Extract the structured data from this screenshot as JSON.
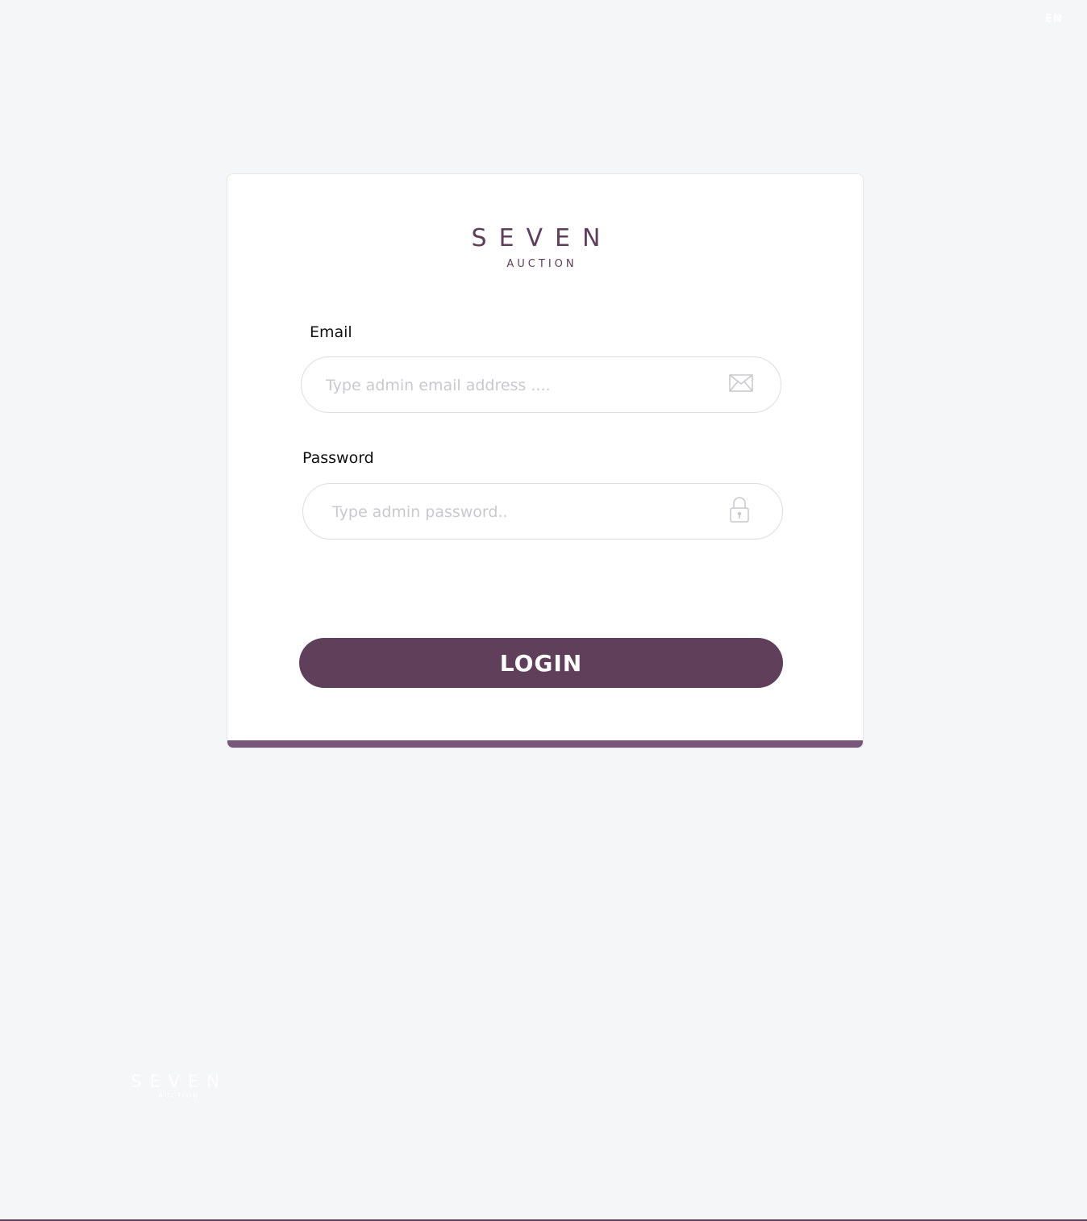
{
  "header": {
    "language": "EN"
  },
  "brand": {
    "name": "SEVEN",
    "subtitle": "AUCTION",
    "color": "#5f3d5b"
  },
  "login_form": {
    "email_label": "Email",
    "email_placeholder": "Type admin email address ....",
    "email_icon": "envelope-icon",
    "password_label": "Password",
    "password_placeholder": "Type admin password..",
    "password_icon": "lock-icon",
    "submit_label": "LOGIN"
  },
  "footer": {
    "logo_name": "SEVEN",
    "logo_subtitle": "AUCTION"
  },
  "colors": {
    "accent": "#5f3f5a",
    "background": "#f5f6f8"
  }
}
